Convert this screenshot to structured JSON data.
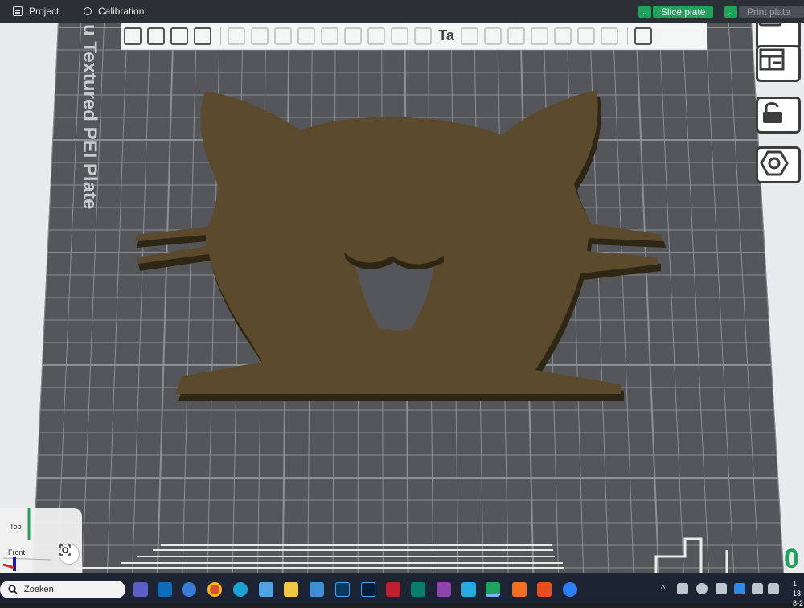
{
  "topbar": {
    "project_label": "Project",
    "calibration_label": "Calibration",
    "slice_label": "Slice plate",
    "print_label": "Print plate",
    "dropdown_glyph": "⌄"
  },
  "viewport": {
    "plate_label": "u Textured PEI Plate",
    "model_color": "#5b4a2c",
    "model_shadow_color": "#2f2716",
    "plate_color": "#555659",
    "grid_color": "#8d8f93",
    "view_top_label": "Top",
    "view_front_label": "Front",
    "layer_value": "0"
  },
  "toolbar": {
    "items": [
      "add-cube-icon",
      "add-plate-icon",
      "auto-orient-icon",
      "arrange-icon",
      "split-icon",
      "move-icon",
      "rotate-icon",
      "scale-icon",
      "lay-on-face-icon",
      "cut-icon",
      "mesh-boolean-icon",
      "support-paint-icon",
      "seam-paint-icon",
      "text-icon",
      "measure-icon",
      "assembly-icon",
      "variable-layer-icon",
      "fuzzy-skin-icon",
      "emboss-icon",
      "brim-ears-icon",
      "color-paint-icon",
      "view-layout-icon"
    ],
    "text_glyph": "Ta"
  },
  "taskbar": {
    "search_label": "Zoeken",
    "date_text": "18-8-2",
    "time_text": "1"
  }
}
